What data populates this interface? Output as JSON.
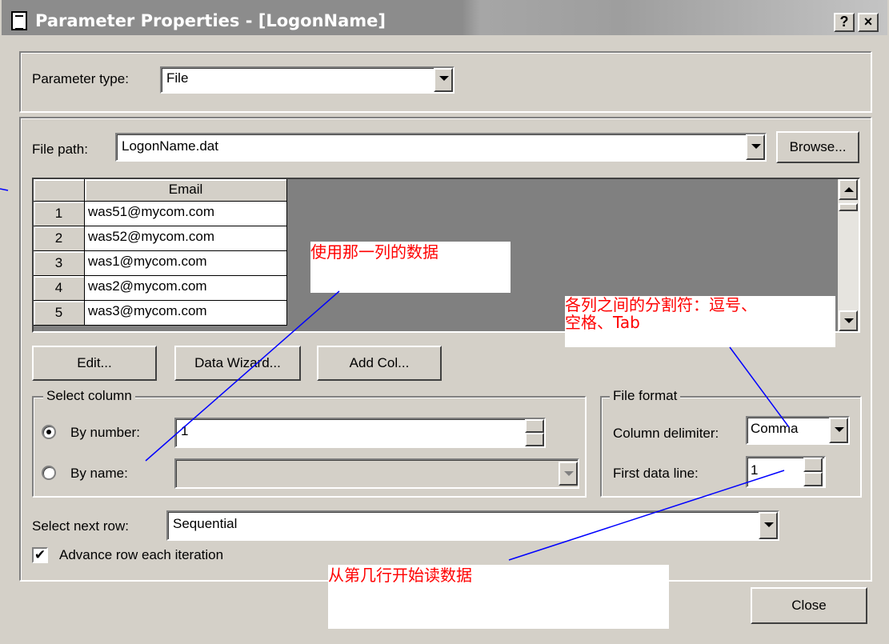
{
  "window": {
    "title": "Parameter Properties - [LogonName]",
    "help_btn": "?",
    "close_btn": "×"
  },
  "parameter_type": {
    "label": "Parameter type:",
    "value": "File"
  },
  "file_path": {
    "label": "File path:",
    "value": "LogonName.dat",
    "browse": "Browse..."
  },
  "grid": {
    "column_header": "Email",
    "rows": [
      {
        "num": "1",
        "value": "was51@mycom.com"
      },
      {
        "num": "2",
        "value": "was52@mycom.com"
      },
      {
        "num": "3",
        "value": "was1@mycom.com"
      },
      {
        "num": "4",
        "value": "was2@mycom.com"
      },
      {
        "num": "5",
        "value": "was3@mycom.com"
      }
    ]
  },
  "buttons": {
    "edit": "Edit...",
    "data_wizard": "Data Wizard...",
    "add_col": "Add Col...",
    "close": "Close"
  },
  "select_column": {
    "group_label": "Select column",
    "by_number": "By number:",
    "by_number_value": "1",
    "by_name": "By name:",
    "selected": "by_number"
  },
  "file_format": {
    "group_label": "File format",
    "column_delimiter_label": "Column delimiter:",
    "column_delimiter_value": "Comma",
    "first_data_line_label": "First data line:",
    "first_data_line_value": "1"
  },
  "next_row": {
    "label": "Select next row:",
    "value": "Sequential"
  },
  "advance_row": {
    "label": "Advance row each iteration",
    "checked": true
  },
  "annotations": {
    "column_note": "使用那一列的数据",
    "delimiter_note_line1": "各列之间的分割符：逗号、",
    "delimiter_note_line2": "空格、Tab",
    "first_line_note": "从第几行开始读数据"
  },
  "colors": {
    "annotation_text": "#ff0000",
    "annotation_line": "#0000ff",
    "dialog_bg": "#d4d0c8"
  }
}
